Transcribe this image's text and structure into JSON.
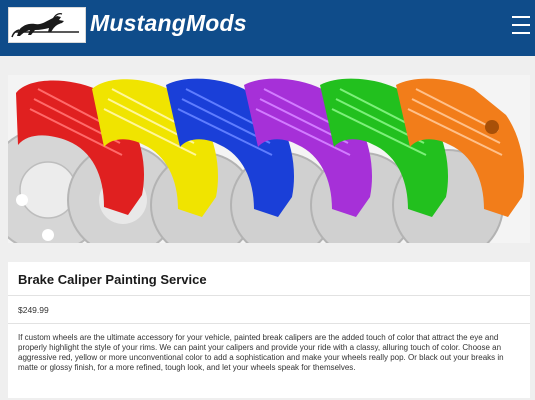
{
  "site": {
    "brand": "MustangMods",
    "logo_icon": "mustang-pony-logo-icon",
    "menu_icon": "hamburger-menu-icon"
  },
  "banner": {
    "image": "brake-calipers-color-lineup",
    "caliper_colors": [
      "#e02020",
      "#f0e400",
      "#1a3fd8",
      "#a630d8",
      "#22c01e",
      "#f27d1a"
    ]
  },
  "product": {
    "title": "Brake Caliper Painting Service",
    "price": "$249.99",
    "description": "If custom wheels are the ultimate accessory for your vehicle, painted break calipers are the added touch of color that attract the eye and properly highlight the style of your rims. We can paint your calipers and provide your ride with a classy, alluring touch of color. Choose an aggressive red, yellow or more unconventional color to add a sophistication and make your wheels really pop. Or black out your breaks in matte or glossy finish, for a more refined, tough look, and let your wheels speak for themselves."
  },
  "colors": {
    "header_bg": "#0f4c8a",
    "page_bg": "#efefef"
  }
}
